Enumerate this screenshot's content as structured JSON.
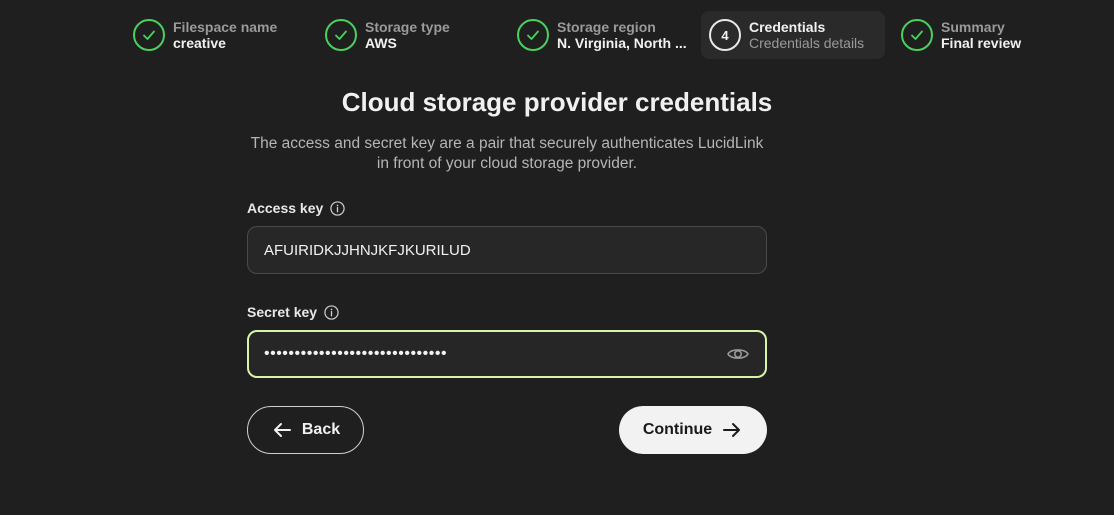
{
  "stepper": {
    "steps": [
      {
        "title": "Filespace name",
        "value": "creative",
        "status": "done"
      },
      {
        "title": "Storage type",
        "value": "AWS",
        "status": "done"
      },
      {
        "title": "Storage region",
        "value": "N. Virginia, North ...",
        "status": "done"
      },
      {
        "number": "4",
        "title": "Credentials",
        "value": "Credentials details",
        "status": "current"
      },
      {
        "title": "Summary",
        "value": "Final review",
        "status": "done"
      }
    ]
  },
  "form": {
    "title": "Cloud storage provider credentials",
    "description": "The access and secret key are a pair that securely authenticates LucidLink in front of your cloud storage provider.",
    "access_key": {
      "label": "Access key",
      "value": "AFUIRIDKJJHNJKFJKURILUD"
    },
    "secret_key": {
      "label": "Secret key",
      "masked_value": "••••••••••••••••••••••••••••••"
    }
  },
  "actions": {
    "back_label": "Back",
    "continue_label": "Continue"
  },
  "colors": {
    "background": "#1f1f1f",
    "done_check": "#4bd05d",
    "focus_border": "#d7f5a8",
    "primary_button": "#f2f2f2"
  }
}
